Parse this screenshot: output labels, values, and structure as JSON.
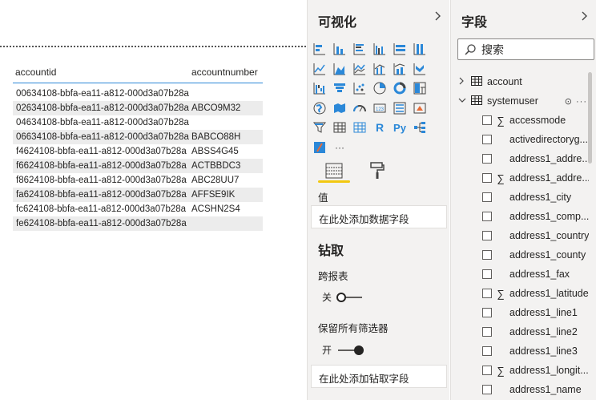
{
  "table": {
    "columns": [
      "accountid",
      "accountnumber"
    ],
    "rows": [
      [
        "00634108-bbfa-ea11-a812-000d3a07b28a",
        ""
      ],
      [
        "02634108-bbfa-ea11-a812-000d3a07b28a",
        "ABCO9M32"
      ],
      [
        "04634108-bbfa-ea11-a812-000d3a07b28a",
        ""
      ],
      [
        "06634108-bbfa-ea11-a812-000d3a07b28a",
        "BABCO88H"
      ],
      [
        "f4624108-bbfa-ea11-a812-000d3a07b28a",
        "ABSS4G45"
      ],
      [
        "f6624108-bbfa-ea11-a812-000d3a07b28a",
        "ACTBBDC3"
      ],
      [
        "f8624108-bbfa-ea11-a812-000d3a07b28a",
        "ABC28UU7"
      ],
      [
        "fa624108-bbfa-ea11-a812-000d3a07b28a",
        "AFFSE9IK"
      ],
      [
        "fc624108-bbfa-ea11-a812-000d3a07b28a",
        "ACSHN2S4"
      ],
      [
        "fe624108-bbfa-ea11-a812-000d3a07b28a",
        ""
      ]
    ]
  },
  "visualizations": {
    "title": "可视化",
    "collapse_icon": "chevron-right-icon",
    "more_label": "···",
    "values_label": "值",
    "values_well": "在此处添加数据字段",
    "drill_title": "钻取",
    "cross_report_label": "跨报表",
    "cross_report_state": "关",
    "keep_filters_label": "保留所有筛选器",
    "keep_filters_state": "开",
    "drill_well": "在此处添加钻取字段",
    "r_label": "R",
    "py_label": "Py"
  },
  "fields": {
    "title": "字段",
    "collapse_icon": "chevron-right-icon",
    "search_placeholder": "搜索",
    "tables": [
      {
        "name": "account",
        "expanded": false
      },
      {
        "name": "systemuser",
        "expanded": true
      }
    ],
    "systemuser_more": "⊙ ···",
    "items": [
      {
        "name": "accessmode",
        "sigma": true
      },
      {
        "name": "activedirectoryg...",
        "sigma": false
      },
      {
        "name": "address1_addre...",
        "sigma": false
      },
      {
        "name": "address1_addre...",
        "sigma": true
      },
      {
        "name": "address1_city",
        "sigma": false
      },
      {
        "name": "address1_comp...",
        "sigma": false
      },
      {
        "name": "address1_country",
        "sigma": false
      },
      {
        "name": "address1_county",
        "sigma": false
      },
      {
        "name": "address1_fax",
        "sigma": false
      },
      {
        "name": "address1_latitude",
        "sigma": true
      },
      {
        "name": "address1_line1",
        "sigma": false
      },
      {
        "name": "address1_line2",
        "sigma": false
      },
      {
        "name": "address1_line3",
        "sigma": false
      },
      {
        "name": "address1_longit...",
        "sigma": true
      },
      {
        "name": "address1_name",
        "sigma": false
      }
    ]
  },
  "colors": {
    "accent_blue": "#2b88d8",
    "tab_underline": "#f2c811",
    "pane_bg": "#f3f2f1"
  }
}
